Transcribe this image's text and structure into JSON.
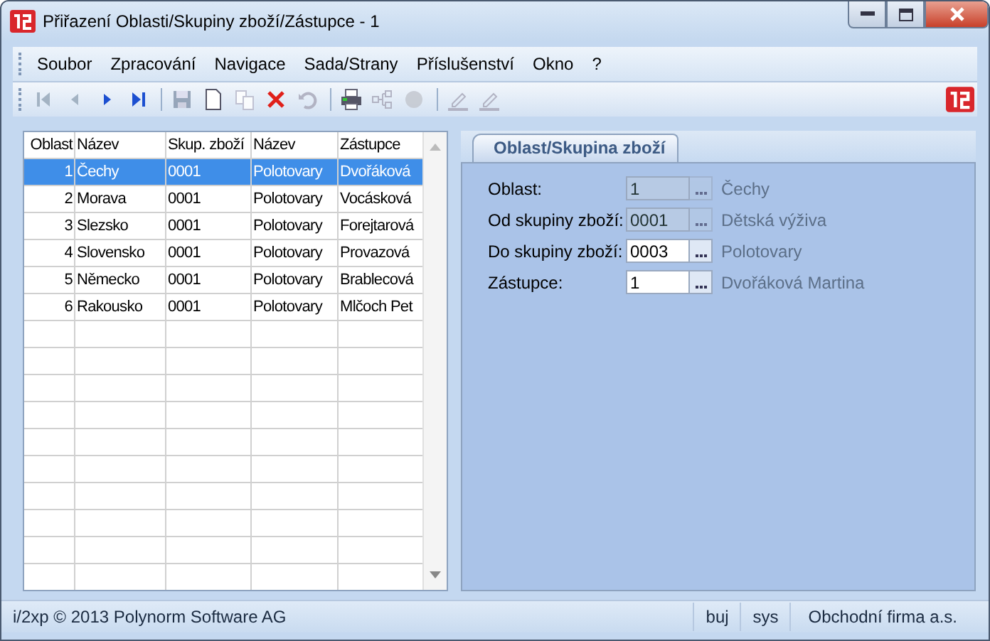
{
  "window": {
    "title": "Přiřazení Oblasti/Skupiny zboží/Zástupce - 1"
  },
  "menu": [
    "Soubor",
    "Zpracování",
    "Navigace",
    "Sada/Strany",
    "Příslušenství",
    "Okno",
    "?"
  ],
  "toolbar": [
    {
      "kind": "first",
      "disabled": true
    },
    {
      "kind": "prev",
      "disabled": true
    },
    {
      "kind": "next",
      "disabled": false
    },
    {
      "kind": "last",
      "disabled": false
    },
    {
      "kind": "sep"
    },
    {
      "kind": "save",
      "disabled": true
    },
    {
      "kind": "new",
      "disabled": false
    },
    {
      "kind": "copy",
      "disabled": true
    },
    {
      "kind": "delete",
      "disabled": false
    },
    {
      "kind": "undo",
      "disabled": true
    },
    {
      "kind": "sep"
    },
    {
      "kind": "print",
      "disabled": false
    },
    {
      "kind": "tree",
      "disabled": true
    },
    {
      "kind": "circle",
      "disabled": true
    },
    {
      "kind": "sep"
    },
    {
      "kind": "pencil",
      "disabled": true
    },
    {
      "kind": "pencil",
      "disabled": true
    }
  ],
  "table": {
    "columns": [
      "Oblast",
      "Název",
      "Skup. zboží",
      "Název",
      "Zástupce"
    ],
    "rows": [
      {
        "selected": true,
        "cells": [
          "1",
          "Čechy",
          "0001",
          "Polotovary",
          "Dvořáková"
        ]
      },
      {
        "selected": false,
        "cells": [
          "2",
          "Morava",
          "0001",
          "Polotovary",
          "Vocásková"
        ]
      },
      {
        "selected": false,
        "cells": [
          "3",
          "Slezsko",
          "0001",
          "Polotovary",
          "Forejtarová"
        ]
      },
      {
        "selected": false,
        "cells": [
          "4",
          "Slovensko",
          "0001",
          "Polotovary",
          "Provazová"
        ]
      },
      {
        "selected": false,
        "cells": [
          "5",
          "Německo",
          "0001",
          "Polotovary",
          "Brablecová"
        ]
      },
      {
        "selected": false,
        "cells": [
          "6",
          "Rakousko",
          "0001",
          "Polotovary",
          "Mlčoch Pet"
        ]
      }
    ]
  },
  "tab": {
    "label": "Oblast/Skupina zboží",
    "selected": true
  },
  "fields": [
    {
      "label": "Oblast:",
      "value": "1",
      "disabled": true,
      "description": "Čechy"
    },
    {
      "label": "Od skupiny zboží:",
      "value": "0001",
      "disabled": true,
      "description": "Dětská výživa"
    },
    {
      "label": "Do skupiny zboží:",
      "value": "0003",
      "disabled": false,
      "description": "Polotovary"
    },
    {
      "label": "Zástupce:",
      "value": "1",
      "disabled": false,
      "description": "Dvořáková Martina"
    }
  ],
  "status_bar": {
    "copyright": "i/2xp © 2013 Polynorm Software AG",
    "user": "buj",
    "system": "sys",
    "company": "Obchodní firma a.s."
  }
}
